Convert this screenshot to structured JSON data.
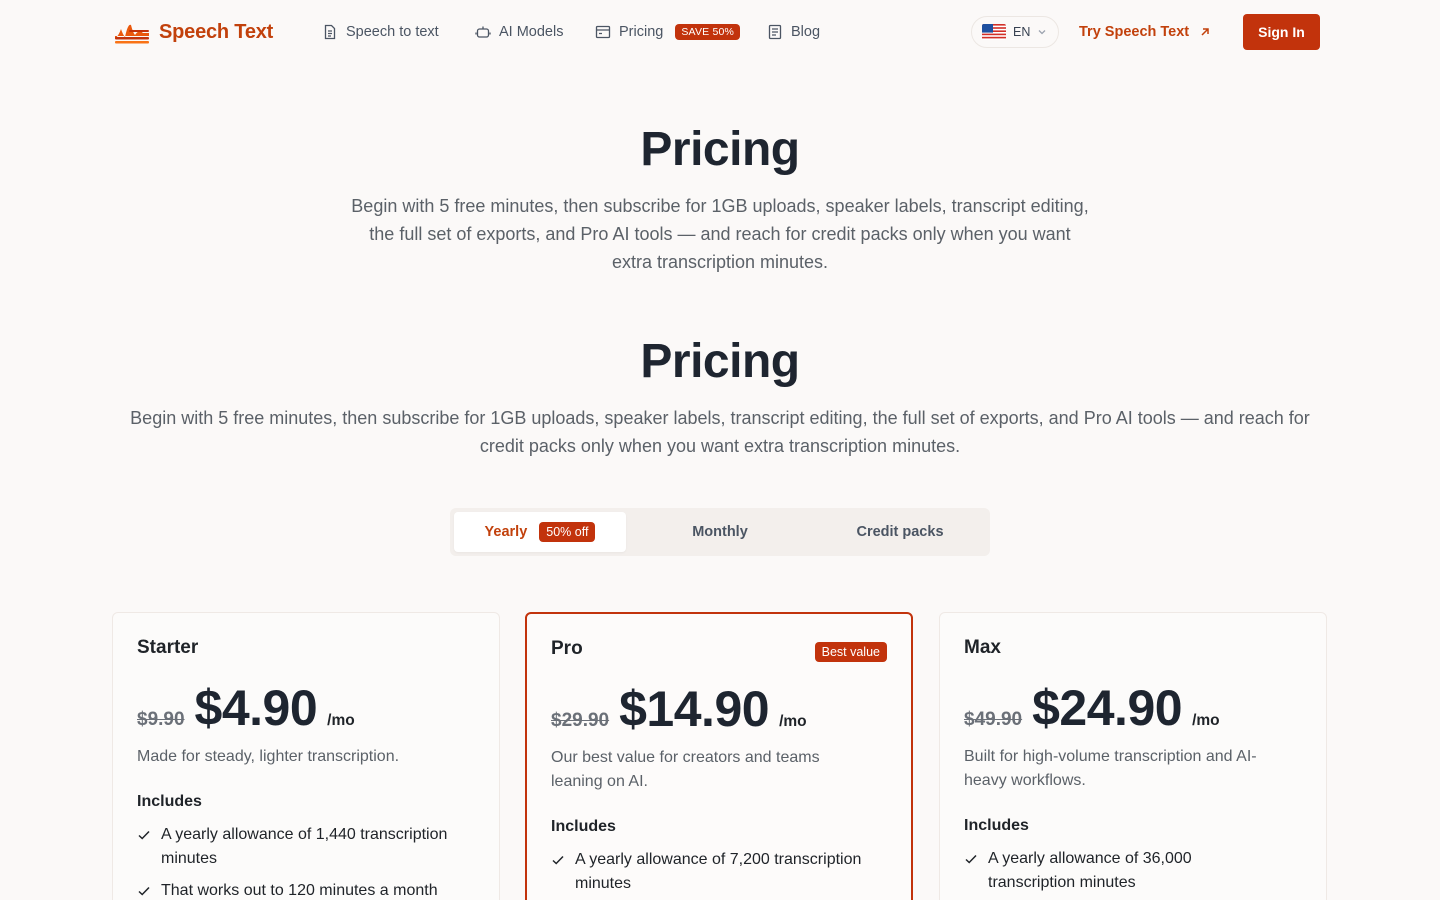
{
  "brand": {
    "name": "Speech Text",
    "accent": "#c2330c"
  },
  "nav": {
    "links": [
      {
        "label": "Speech to text",
        "icon": "document-icon"
      },
      {
        "label": "AI Models",
        "icon": "robot-icon"
      },
      {
        "label": "Pricing",
        "icon": "pricing-icon",
        "badge": "SAVE 50%"
      },
      {
        "label": "Blog",
        "icon": "blog-icon"
      }
    ],
    "language": "EN",
    "try_label": "Try Speech Text",
    "signin_label": "Sign In"
  },
  "hero": {
    "title": "Pricing",
    "subtitle_lines": [
      "Begin with 5 free minutes, then subscribe for 1GB uploads, speaker labels, transcript editing,",
      "the full set of exports, and Pro AI tools — and reach for credit packs only when you want",
      "extra transcription minutes."
    ]
  },
  "section": {
    "title": "Pricing",
    "subtitle_lines": [
      "Begin with 5 free minutes, then subscribe for 1GB uploads, speaker labels, transcript editing, the full set of exports, and Pro AI tools — and reach for",
      "credit packs only when you want extra transcription minutes."
    ]
  },
  "tabs": {
    "yearly": "Yearly",
    "yearly_badge": "50% off",
    "monthly": "Monthly",
    "credits": "Credit packs"
  },
  "plans": [
    {
      "name": "Starter",
      "old_price": "$9.90",
      "price": "$4.90",
      "per": "/mo",
      "desc_lines": [
        "Made for steady, lighter transcription."
      ],
      "includes_label": "Includes",
      "features": [
        [
          "A yearly allowance of 1,440 transcription",
          "minutes"
        ],
        [
          "That works out to 120 minutes a month"
        ]
      ]
    },
    {
      "name": "Pro",
      "badge": "Best value",
      "old_price": "$29.90",
      "price": "$14.90",
      "per": "/mo",
      "desc_lines": [
        "Our best value for creators and teams",
        "leaning on AI."
      ],
      "includes_label": "Includes",
      "features": [
        [
          "A yearly allowance of 7,200 transcription",
          "minutes"
        ]
      ]
    },
    {
      "name": "Max",
      "old_price": "$49.90",
      "price": "$24.90",
      "per": "/mo",
      "desc_lines": [
        "Built for high-volume transcription and AI-",
        "heavy workflows."
      ],
      "includes_label": "Includes",
      "features": [
        [
          "A yearly allowance of 36,000",
          "transcription minutes"
        ]
      ]
    }
  ]
}
